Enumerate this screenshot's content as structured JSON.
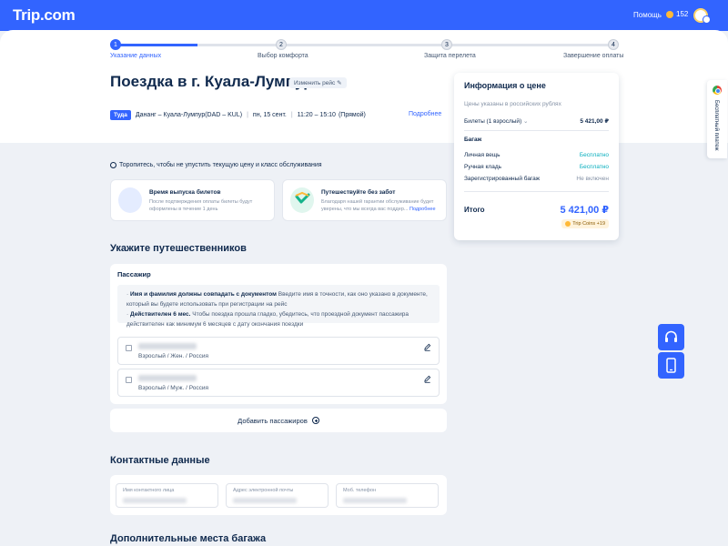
{
  "header": {
    "logo": "Trip.com",
    "help": "Помощь",
    "coins": "152"
  },
  "stepper": {
    "steps": [
      {
        "num": "1",
        "label": "Указание данных"
      },
      {
        "num": "2",
        "label": "Выбор комфорта"
      },
      {
        "num": "3",
        "label": "Защита перелета"
      },
      {
        "num": "4",
        "label": "Завершение оплаты"
      }
    ]
  },
  "trip": {
    "title": "Поездка в г. Куала-Лумпур",
    "change_flight": "Изменить рейс",
    "direction_tag": "Туда",
    "route": "Дананг – Куала-Лумпур(DAD – KUL)",
    "date": "пн, 15 сент.",
    "time": "11:20 – 15:10",
    "stops": "(Прямой)",
    "details": "Подробнее"
  },
  "price": {
    "title": "Информация о цене",
    "note": "Цены указаны в российских рублях",
    "tickets_label": "Билеты (1 взрослый)",
    "tickets_value": "5 421,00 ₽",
    "baggage_title": "Багаж",
    "baggage": [
      {
        "label": "Личная вещь",
        "value": "Бесплатно"
      },
      {
        "label": "Ручная кладь",
        "value": "Бесплатно"
      },
      {
        "label": "Зарегистрированный багаж",
        "value": "Не включен"
      }
    ],
    "total_label": "Итого",
    "total_value": "5 421,00 ₽",
    "trip_coins": "Trip Coins +19"
  },
  "urgency": "Торопитесь, чтобы не упустить текущую цену и класс обслуживания",
  "info_cards": [
    {
      "title": "Время выпуска билетов",
      "text": "После подтверждения оплаты билеты будут оформлены в течение 1 день",
      "link": ""
    },
    {
      "title": "Путешествуйте без забот",
      "text": "Благодаря нашей гарантии обслуживание будет уверены, что мы всегда вас поддер...",
      "link": "Подробнее"
    }
  ],
  "travellers": {
    "section_title": "Укажите путешественников",
    "passenger_label": "Пассажир",
    "notice_1_bold": "Имя и фамилия должны совпадать с документом",
    "notice_1_text": "Введите имя в точности, как оно указано в документе, который вы будете использовать при регистрации на рейс",
    "notice_2_bold": "Действителен 6 мес.",
    "notice_2_text": "Чтобы поездка прошла гладко, убедитесь, что проездной документ пассажира действителен как минимум 6 месяцев с дату окончания поездки",
    "passengers": [
      {
        "meta": "Взрослый / Жен. / Россия"
      },
      {
        "meta": "Взрослый / Муж. / Россия"
      }
    ],
    "add_button": "Добавить пассажиров"
  },
  "contact": {
    "section_title": "Контактные данные",
    "fields": [
      {
        "label": "Имя контактного лица"
      },
      {
        "label": "Адрес электронной почты"
      },
      {
        "label": "Моб. телефон"
      }
    ]
  },
  "extra_baggage": {
    "section_title": "Дополнительные места багажа"
  },
  "side_tab": {
    "label": "Бесплатный платеж"
  }
}
